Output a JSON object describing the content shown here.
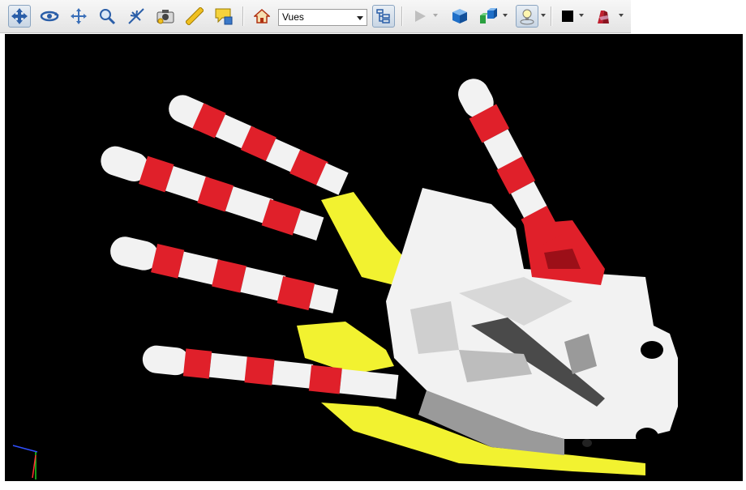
{
  "toolbar": {
    "buttons": [
      {
        "name": "select-tool",
        "icon": "move-arrows-icon",
        "active": true
      },
      {
        "name": "rotate-view",
        "icon": "rotate-icon",
        "active": false
      },
      {
        "name": "pan-view",
        "icon": "pan-icon",
        "active": false
      },
      {
        "name": "zoom-view",
        "icon": "zoom-icon",
        "active": false
      },
      {
        "name": "fly-view",
        "icon": "fly-icon",
        "active": false
      },
      {
        "name": "camera-capture",
        "icon": "camera-icon",
        "active": false
      },
      {
        "name": "measure",
        "icon": "ruler-icon",
        "active": false
      },
      {
        "name": "comment",
        "icon": "comment-icon",
        "active": false
      }
    ],
    "home_icon": "home-icon",
    "views_select": {
      "value": "Vues"
    },
    "tree_icon": "tree-icon",
    "play_icon": "play-icon",
    "render_icon": "cube-icon",
    "explode_icon": "explode-icon",
    "light_icon": "light-icon",
    "background_color": "#000000",
    "section_icon": "section-icon"
  },
  "scene": {
    "background": "#000000",
    "colors": {
      "red": "#e0202a",
      "white": "#f2f2f2",
      "yellow": "#f2f230",
      "shade": "#9a9a9a"
    }
  }
}
